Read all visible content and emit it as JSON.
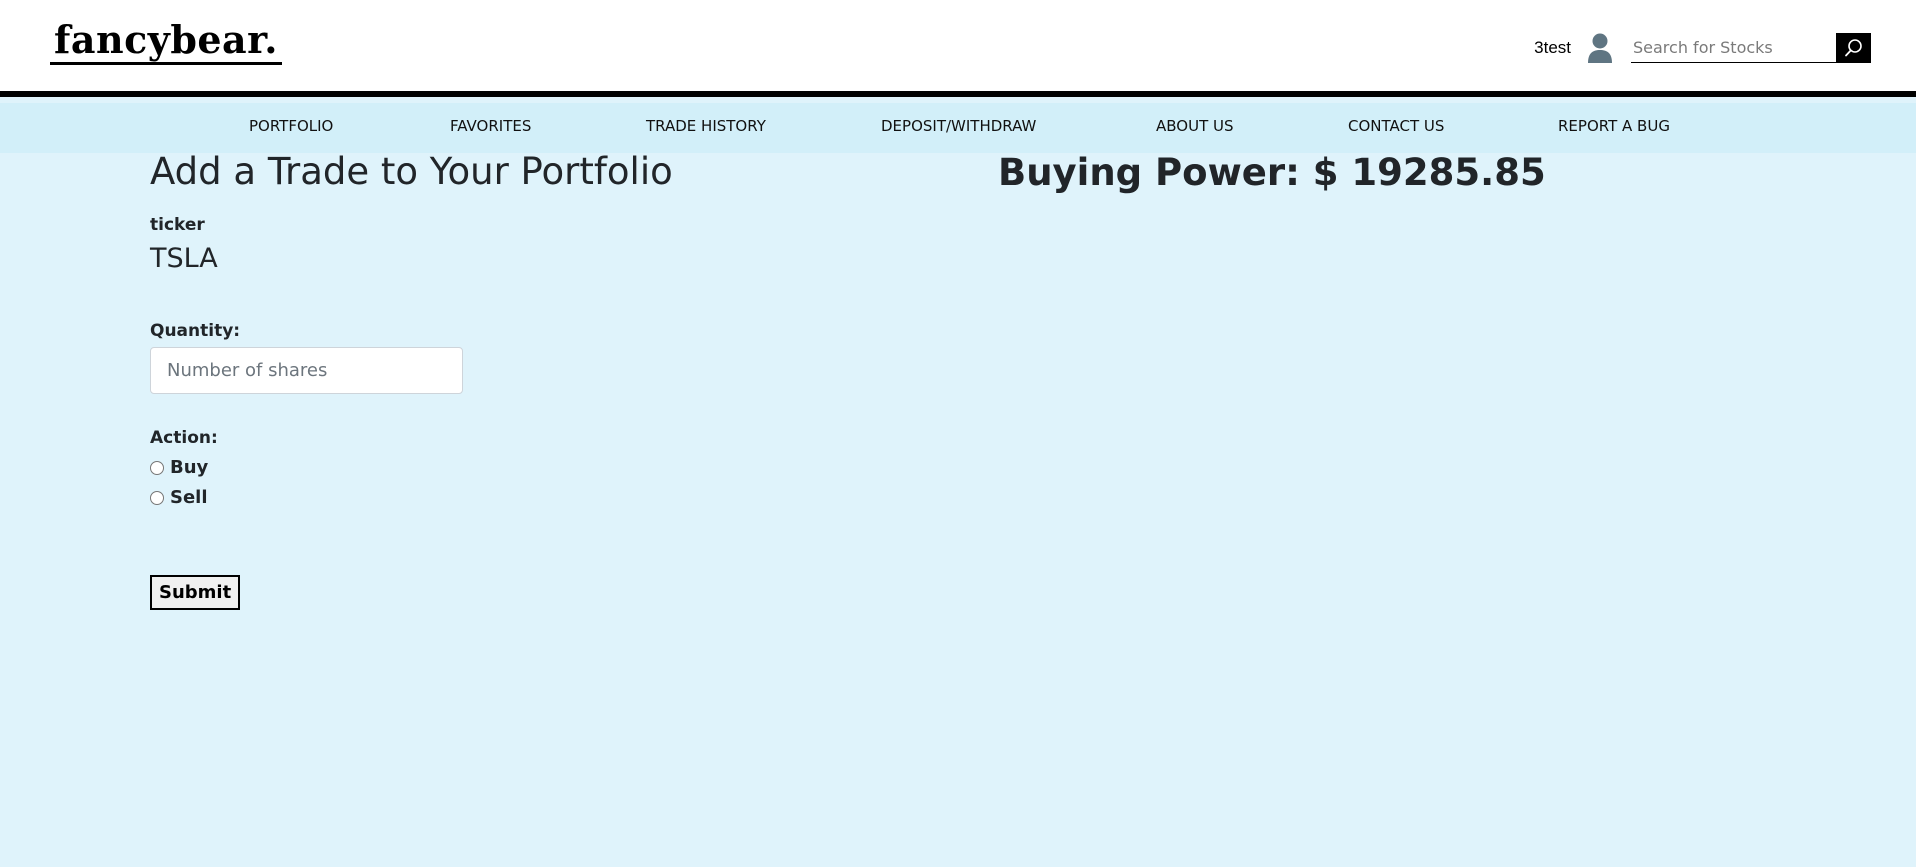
{
  "header": {
    "logo_text": "fancybear.",
    "username": "3test",
    "search_placeholder": "Search for Stocks"
  },
  "nav": {
    "items": [
      {
        "label": "PORTFOLIO"
      },
      {
        "label": "FAVORITES"
      },
      {
        "label": "TRADE HISTORY"
      },
      {
        "label": "DEPOSIT/WITHDRAW"
      },
      {
        "label": "ABOUT US"
      },
      {
        "label": "CONTACT US"
      },
      {
        "label": "REPORT A BUG"
      }
    ]
  },
  "main": {
    "title": "Add a Trade to Your Portfolio",
    "buying_power": "Buying Power: $ 19285.85",
    "ticker_label": "ticker",
    "ticker_value": "TSLA",
    "quantity_label": "Quantity:",
    "quantity_placeholder": "Number of shares",
    "action_label": "Action:",
    "actions": [
      {
        "label": "Buy"
      },
      {
        "label": "Sell"
      }
    ],
    "submit_label": "Submit"
  },
  "icons": {
    "user": "user-icon",
    "search": "search-icon"
  },
  "colors": {
    "background": "#dff3fb",
    "nav_background": "#d2eff9",
    "header_background": "#ffffff",
    "header_border": "#000000",
    "user_icon": "#5f7582"
  }
}
